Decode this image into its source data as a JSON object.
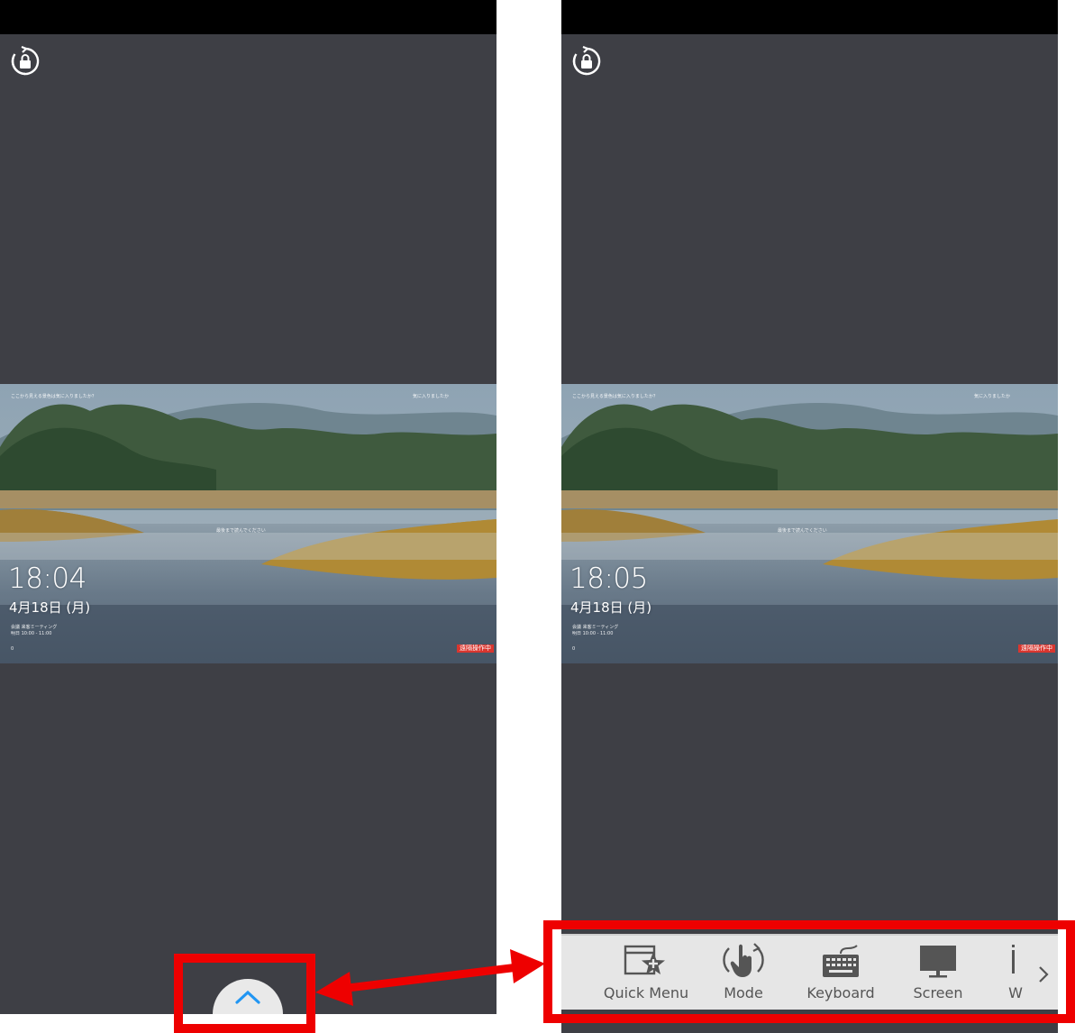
{
  "left_screen": {
    "clock": "18:04",
    "date": "4月18日 (月)",
    "top_notice": "ここから見える景色は気に入りましたか？",
    "top_right_notice": "気に入りましたか",
    "center_notice": "最後まで読んでください",
    "event_line1": "会議 来客ミーティング",
    "event_line2": "明日 10:00 - 11:00",
    "footer_icon_label": "0",
    "badge": "遠隔操作中"
  },
  "right_screen": {
    "clock": "18:05",
    "date": "4月18日 (月)",
    "top_notice": "ここから見える景色は気に入りましたか？",
    "top_right_notice": "気に入りましたか",
    "center_notice": "最後まで読んでください",
    "event_line1": "会議 来客ミーティング",
    "event_line2": "明日 10:00 - 11:00",
    "footer_icon_label": "0",
    "badge": "遠隔操作中"
  },
  "toolbar": {
    "items": [
      {
        "label": "Quick Menu",
        "icon": "quick-menu-icon"
      },
      {
        "label": "Mode",
        "icon": "touch-mode-icon"
      },
      {
        "label": "Keyboard",
        "icon": "keyboard-icon"
      },
      {
        "label": "Screen",
        "icon": "monitor-icon"
      },
      {
        "label": "W",
        "icon": "partial-icon"
      }
    ],
    "more_icon": "chevron-right-icon",
    "expand_icon": "chevron-up-icon"
  },
  "colors": {
    "phone_bg": "#3e3f45",
    "highlight": "#ee0000",
    "accent": "#2196f3",
    "dock_bg": "#e6e6e6"
  }
}
